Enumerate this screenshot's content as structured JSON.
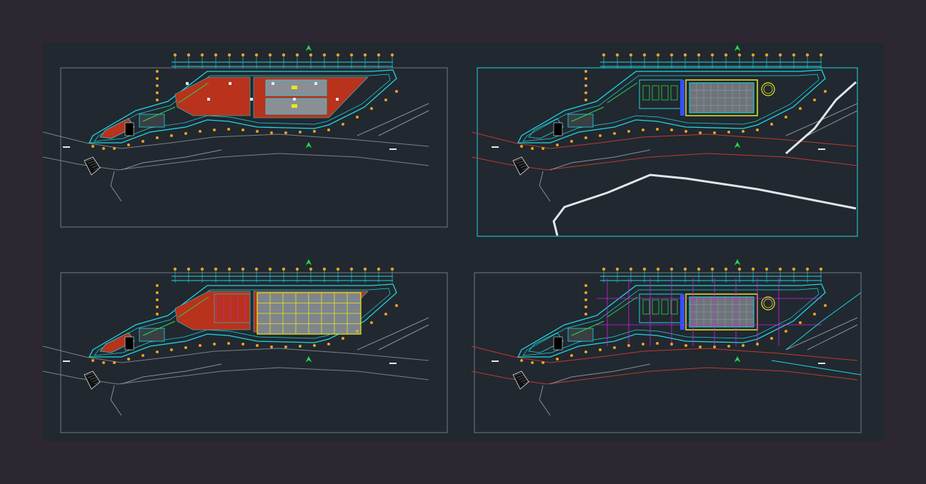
{
  "drawing": {
    "background_color": "#2c2730",
    "modelspace_color": "#212830",
    "sheets": [
      {
        "id": "plan-top-left",
        "fill": "roof-red",
        "grid": "solid-gray"
      },
      {
        "id": "plan-top-right",
        "fill": "structure-cyan",
        "grid": "hatched"
      },
      {
        "id": "plan-bottom-left",
        "fill": "roof-red",
        "grid": "yellow-grid"
      },
      {
        "id": "plan-bottom-right",
        "fill": "structure-magenta",
        "grid": "hatched"
      }
    ],
    "palette": {
      "cyan": "#1fd6e0",
      "red": "#b8321c",
      "yellow": "#e8e81a",
      "magenta": "#d21ee0",
      "green": "#27d84b",
      "orange": "#f0a020",
      "white": "#e8e8e8",
      "gray": "#8a8f96",
      "road": "#c03a2a",
      "blue": "#3050ff"
    }
  }
}
